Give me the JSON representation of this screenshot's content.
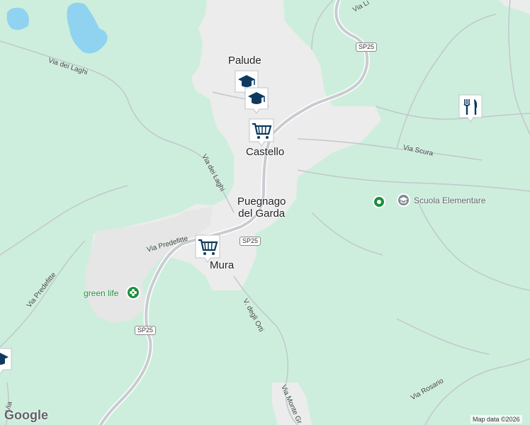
{
  "places": {
    "palude": "Palude",
    "castello": "Castello",
    "puegnago": "Puegnago\ndel Garda",
    "mura": "Mura"
  },
  "roads": {
    "via_dei_laghi_top": "Via dei Laghi",
    "via_dei_laghi_mid": "Via dei Laghi",
    "via_scura": "Via Scura",
    "via_predefitte_1": "Via Predefitte",
    "via_predefitte_2": "Via Predefitte",
    "v_degli_orti": "V. degli Orti",
    "via_rosario": "Via Rosario",
    "via_monte": "Via Monte Gr",
    "via_li": "Via Li",
    "via_left_edge": "Via"
  },
  "shields": {
    "sp25_top": "SP25",
    "sp25_mid": "SP25",
    "sp25_bottom": "SP25"
  },
  "pois": {
    "scuola": "Scuola Elementare",
    "green_life": "green life"
  },
  "footer": {
    "attribution": "Map data ©2026",
    "logo": "Google"
  },
  "icons": {
    "school": "school-icon",
    "cart": "shopping-cart-icon",
    "restaurant": "restaurant-icon"
  },
  "colors": {
    "land": "#cdeedd",
    "water": "#8fd3f0",
    "urban": "#ececec",
    "marker_bg": "#ffffff",
    "marker_fg": "#0d3a5e",
    "poi_green": "#1e8e3e"
  }
}
